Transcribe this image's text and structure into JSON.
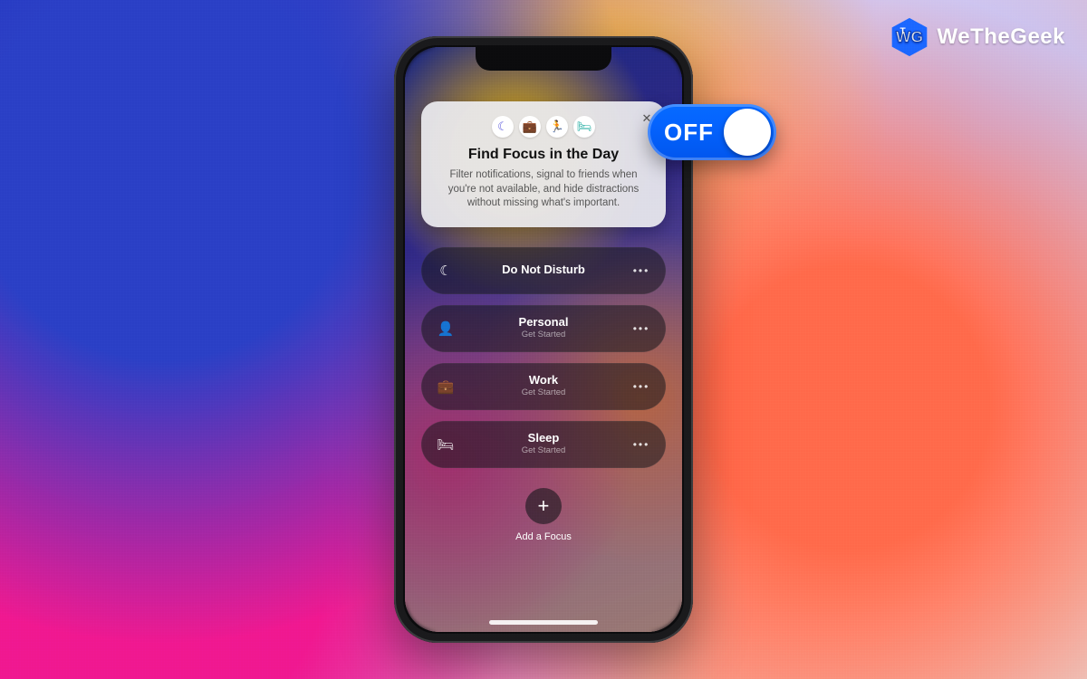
{
  "brand": {
    "text": "WeTheGeek",
    "badge_letters": "WTG"
  },
  "toggle": {
    "label": "OFF"
  },
  "info_card": {
    "title": "Find Focus in the Day",
    "description": "Filter notifications, signal to friends when you're not available, and hide distractions without missing what's important.",
    "icons": [
      "moon",
      "work",
      "run",
      "bed"
    ]
  },
  "modes": [
    {
      "icon": "moon",
      "title": "Do Not Disturb",
      "subtitle": ""
    },
    {
      "icon": "person",
      "title": "Personal",
      "subtitle": "Get Started"
    },
    {
      "icon": "work",
      "title": "Work",
      "subtitle": "Get Started"
    },
    {
      "icon": "bed",
      "title": "Sleep",
      "subtitle": "Get Started"
    }
  ],
  "add": {
    "label": "Add a Focus",
    "plus": "+"
  },
  "glyphs": {
    "moon": "☾",
    "work": "💼",
    "run": "🏃",
    "bed": "🛏",
    "person": "👤",
    "close": "✕",
    "dots": "•••"
  }
}
